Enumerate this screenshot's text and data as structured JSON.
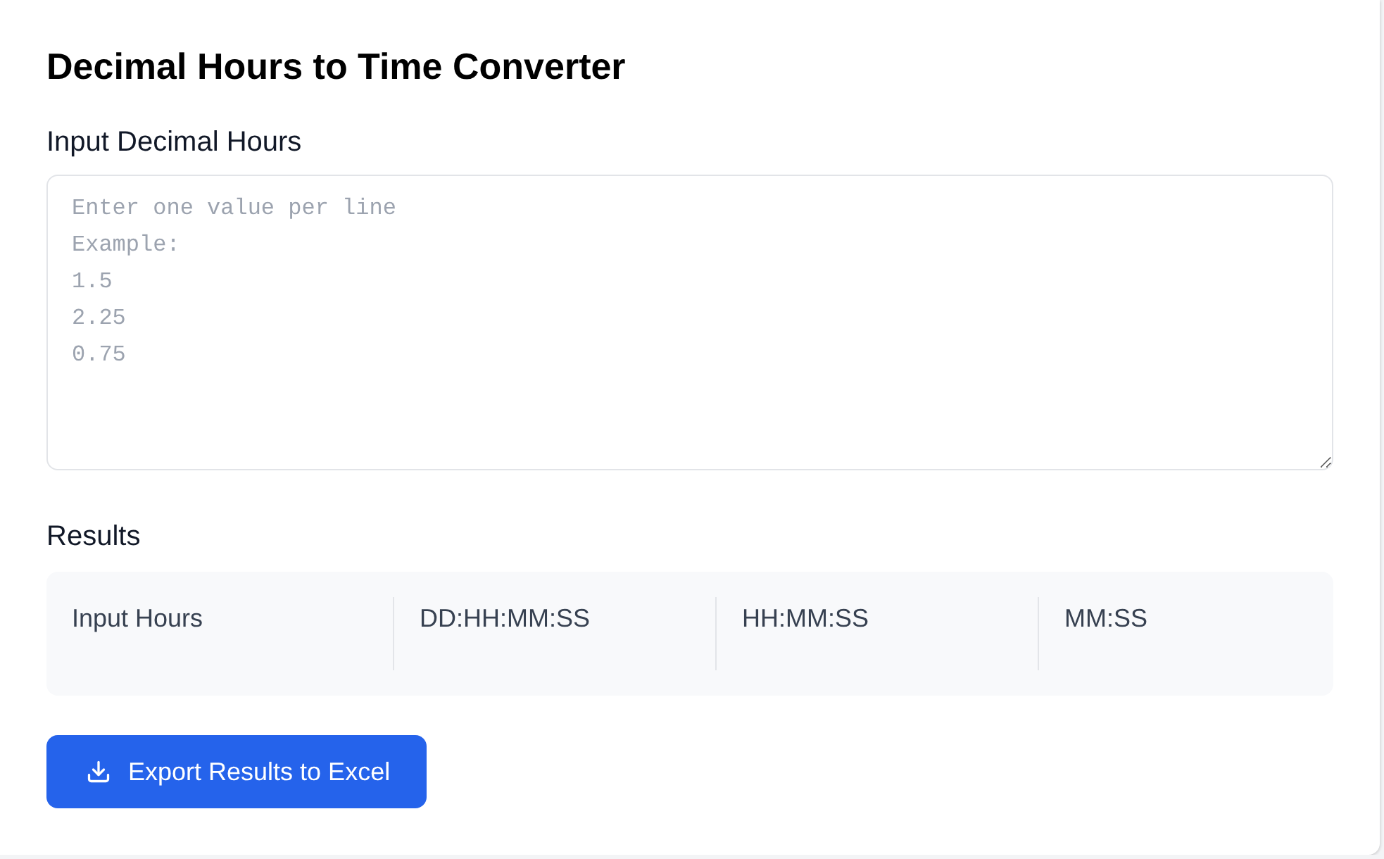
{
  "title": "Decimal Hours to Time Converter",
  "input": {
    "label": "Input Decimal Hours",
    "placeholder": "Enter one value per line\nExample:\n1.5\n2.25\n0.75"
  },
  "results": {
    "label": "Results",
    "table": {
      "columns": [
        "Input Hours",
        "DD:HH:MM:SS",
        "HH:MM:SS",
        "MM:SS"
      ]
    }
  },
  "export_button": {
    "label": "Export Results to Excel"
  }
}
